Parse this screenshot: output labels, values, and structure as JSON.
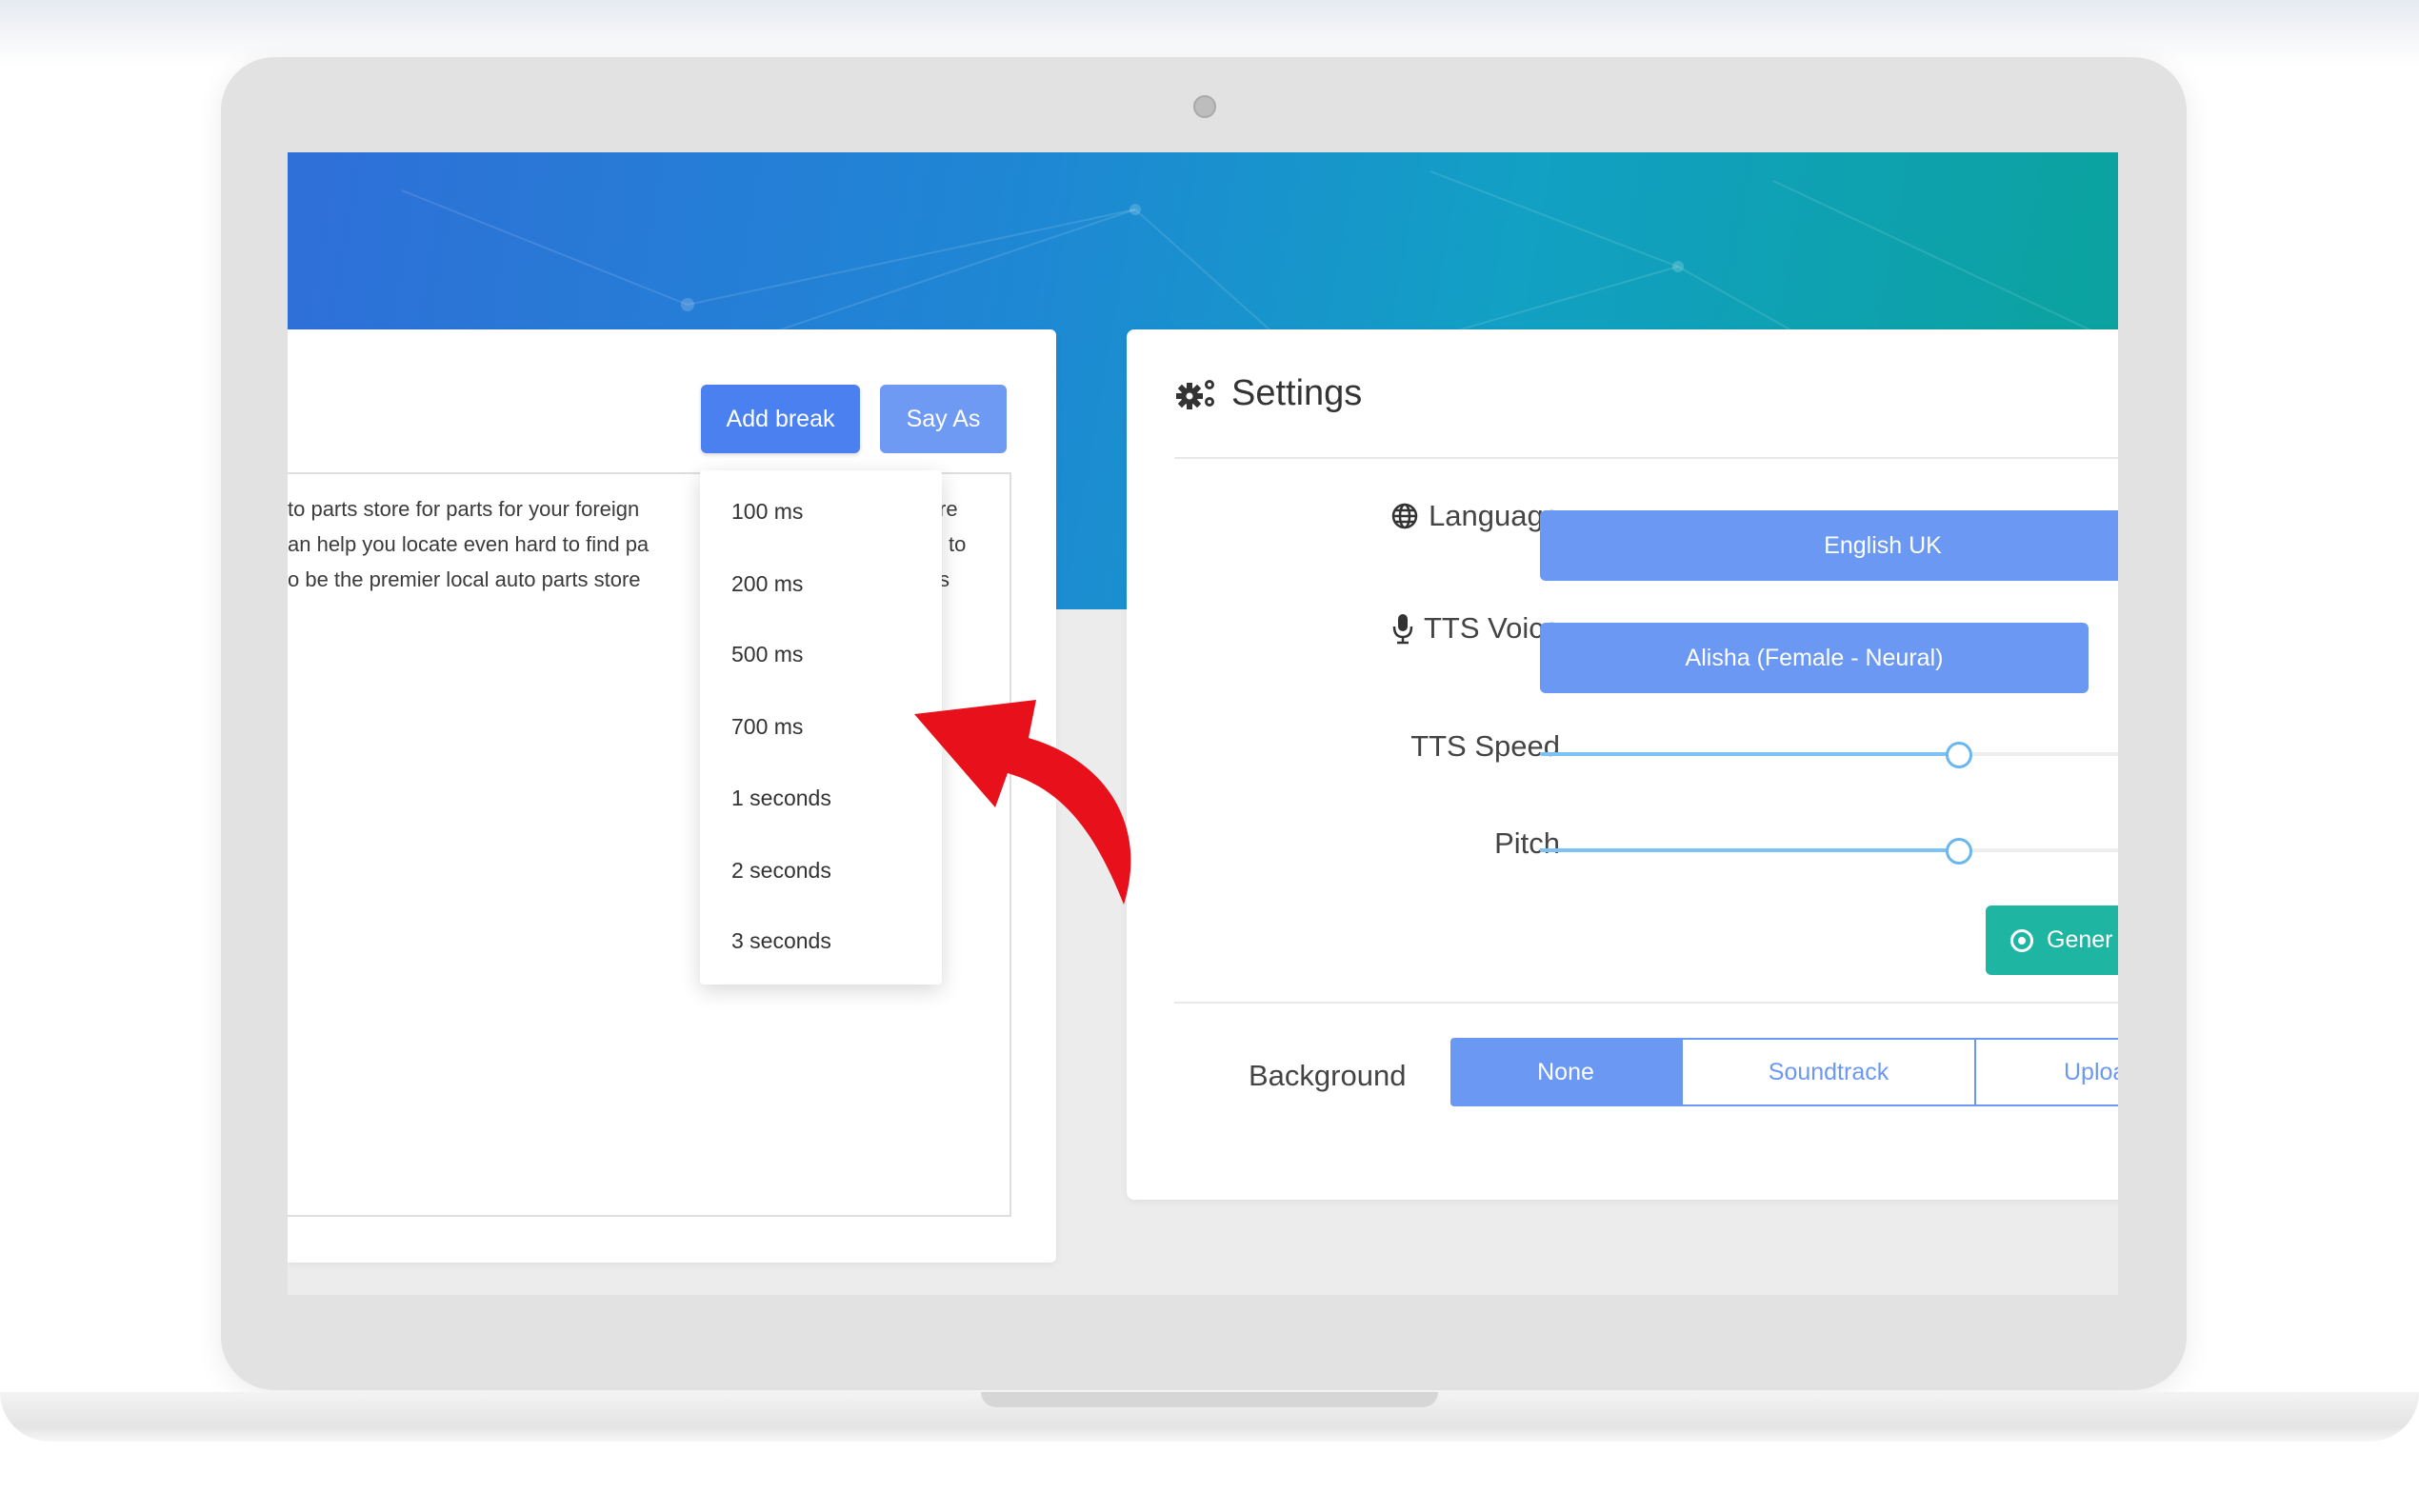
{
  "editor": {
    "add_break_label": "Add break",
    "say_as_label": "Say As",
    "text_lines": [
      "to parts store for parts for your foreign",
      "an help you locate even hard to find pa",
      "o be the premier local auto parts store"
    ],
    "text_tails": [
      "re",
      "to",
      "s"
    ],
    "break_options": [
      "100 ms",
      "200 ms",
      "500 ms",
      "700 ms",
      "1 seconds",
      "2 seconds",
      "3 seconds"
    ]
  },
  "settings": {
    "title": "Settings",
    "language_label": "Language",
    "language_value": "English UK",
    "voice_label": "TTS Voice",
    "voice_value": "Alisha (Female - Neural)",
    "speed_label": "TTS Speed",
    "speed_value_fraction": 0.61,
    "pitch_label": "Pitch",
    "pitch_value_fraction": 0.61,
    "generate_label": "Gener",
    "background_label": "Background",
    "background_options": [
      "None",
      "Soundtrack",
      "Uploa"
    ],
    "background_selected": "None"
  },
  "colors": {
    "primary": "#4a80ef",
    "primary_light": "#6a98f3",
    "teal": "#1fb5a3",
    "arrow": "#e8101a"
  },
  "icons": {
    "settings": "gears-icon",
    "language": "globe-icon",
    "voice": "microphone-icon",
    "generate": "play-circle-icon",
    "annotation": "curved-arrow-icon"
  }
}
